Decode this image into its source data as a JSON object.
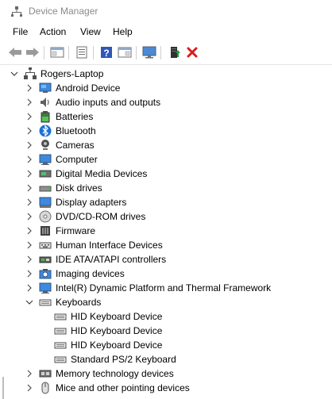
{
  "window": {
    "title": "Device Manager"
  },
  "menu": {
    "items": [
      "File",
      "Action",
      "View",
      "Help"
    ]
  },
  "toolbar": {
    "buttons": [
      "back-icon",
      "forward-icon",
      "show-hide-console-tree-icon",
      "properties-icon",
      "help-icon",
      "action-pane-icon",
      "monitor-icon",
      "update-driver-icon",
      "uninstall-icon"
    ]
  },
  "colors": {
    "accent_blue": "#2f6fcf",
    "uninstall_red": "#d81e1e",
    "update_green": "#1a9e3a",
    "title_gray": "#8a8a8a"
  },
  "tree": {
    "root": {
      "label": "Rogers-Laptop",
      "icon": "computer-root-icon",
      "expanded": true
    },
    "categories": [
      {
        "label": "Android Device",
        "icon": "android-device-icon",
        "expanded": false
      },
      {
        "label": "Audio inputs and outputs",
        "icon": "audio-icon",
        "expanded": false
      },
      {
        "label": "Batteries",
        "icon": "battery-icon",
        "expanded": false
      },
      {
        "label": "Bluetooth",
        "icon": "bluetooth-icon",
        "expanded": false
      },
      {
        "label": "Cameras",
        "icon": "camera-icon",
        "expanded": false
      },
      {
        "label": "Computer",
        "icon": "computer-icon",
        "expanded": false
      },
      {
        "label": "Digital Media Devices",
        "icon": "media-device-icon",
        "expanded": false
      },
      {
        "label": "Disk drives",
        "icon": "disk-drive-icon",
        "expanded": false
      },
      {
        "label": "Display adapters",
        "icon": "display-adapter-icon",
        "expanded": false
      },
      {
        "label": "DVD/CD-ROM drives",
        "icon": "dvd-icon",
        "expanded": false
      },
      {
        "label": "Firmware",
        "icon": "firmware-icon",
        "expanded": false
      },
      {
        "label": "Human Interface Devices",
        "icon": "hid-icon",
        "expanded": false
      },
      {
        "label": "IDE ATA/ATAPI controllers",
        "icon": "ide-controller-icon",
        "expanded": false
      },
      {
        "label": "Imaging devices",
        "icon": "imaging-icon",
        "expanded": false
      },
      {
        "label": "Intel(R) Dynamic Platform and Thermal Framework",
        "icon": "intel-framework-icon",
        "expanded": false
      },
      {
        "label": "Keyboards",
        "icon": "keyboard-icon",
        "expanded": true,
        "children": [
          {
            "label": "HID Keyboard Device",
            "icon": "keyboard-icon"
          },
          {
            "label": "HID Keyboard Device",
            "icon": "keyboard-icon"
          },
          {
            "label": "HID Keyboard Device",
            "icon": "keyboard-icon"
          },
          {
            "label": "Standard PS/2 Keyboard",
            "icon": "keyboard-icon"
          }
        ]
      },
      {
        "label": "Memory technology devices",
        "icon": "memory-icon",
        "expanded": false
      },
      {
        "label": "Mice and other pointing devices",
        "icon": "mouse-icon",
        "expanded": false
      }
    ]
  }
}
